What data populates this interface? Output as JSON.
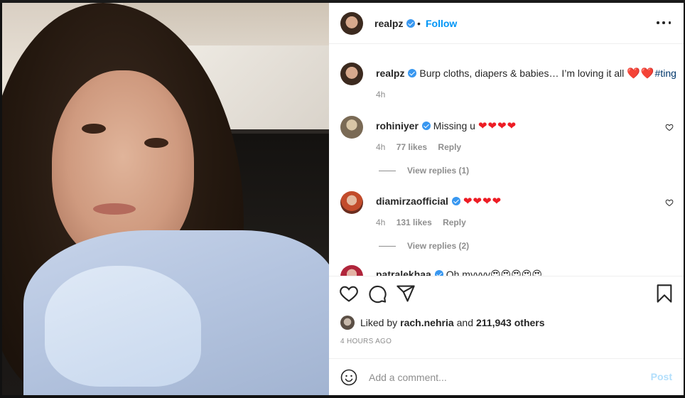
{
  "post": {
    "author": "realpz",
    "follow_label": "Follow",
    "separator": "•",
    "caption": "Burp cloths, diapers & babies… I’m loving it all",
    "caption_hearts": "❤️❤️",
    "caption_hashtag": "#ting",
    "caption_time": "4h"
  },
  "comments": [
    {
      "username": "rohiniyer",
      "text": "Missing u",
      "emoji": "❤❤❤❤",
      "time": "4h",
      "likes": "77 likes",
      "reply_label": "Reply",
      "view_replies": "View replies (1)"
    },
    {
      "username": "diamirzaofficial",
      "text": "",
      "emoji": "❤❤❤❤",
      "time": "4h",
      "likes": "131 likes",
      "reply_label": "Reply",
      "view_replies": "View replies (2)"
    },
    {
      "username": "patralekhaa",
      "text": "Oh myyyy",
      "emoji": "😍😍😍😍😍"
    }
  ],
  "likes": {
    "prefix": "Liked by",
    "user": "rach.nehria",
    "conjunction": "and",
    "others": "211,943 others"
  },
  "timestamp": "4 HOURS AGO",
  "add_comment": {
    "placeholder": "Add a comment...",
    "post_label": "Post"
  },
  "colors": {
    "follow": "#0095f6",
    "verified": "#3897f0",
    "post_disabled": "#b2dffc",
    "heart": "#ed1c24"
  },
  "icons": [
    "more-options-icon",
    "verified-badge-icon",
    "heart-icon",
    "comment-icon",
    "share-icon",
    "bookmark-icon",
    "emoji-icon",
    "comment-like-icon"
  ]
}
